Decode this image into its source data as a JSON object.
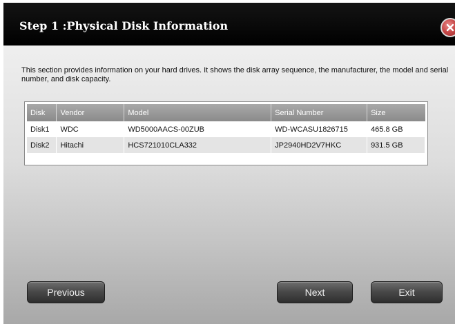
{
  "dialog": {
    "title": "Step 1 :Physical Disk Information",
    "description": "This section provides information on your hard drives. It shows the disk array sequence, the manufacturer, the model and serial number, and disk capacity."
  },
  "table": {
    "headers": [
      "Disk",
      "Vendor",
      "Model",
      "Serial Number",
      "Size"
    ],
    "rows": [
      [
        "Disk1",
        "WDC",
        "WD5000AACS-00ZUB",
        "WD-WCASU1826715",
        "465.8 GB"
      ],
      [
        "Disk2",
        "Hitachi",
        "HCS721010CLA332",
        "JP2940HD2V7HKC",
        "931.5 GB"
      ]
    ]
  },
  "buttons": {
    "previous": "Previous",
    "next": "Next",
    "exit": "Exit"
  },
  "icons": {
    "close": "close-icon"
  },
  "colors": {
    "titlebar": "#000000",
    "close_button": "#c94b4b",
    "table_header": "#9a9a9a",
    "button": "#4a4a4a"
  }
}
